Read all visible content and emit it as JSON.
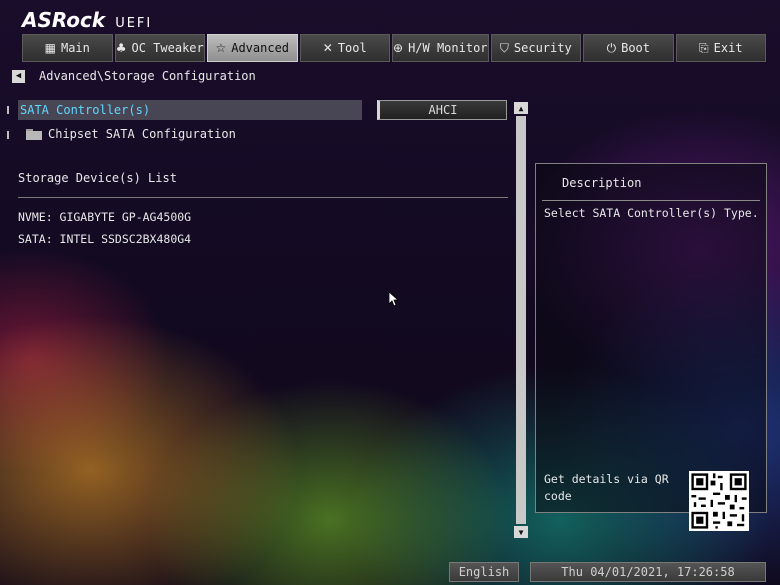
{
  "brand": {
    "name": "ASRock",
    "product": "UEFI"
  },
  "tabs": [
    {
      "label": "Main",
      "icon": "grid-icon",
      "active": false
    },
    {
      "label": "OC Tweaker",
      "icon": "rocket-icon",
      "active": false
    },
    {
      "label": "Advanced",
      "icon": "star-icon",
      "active": true
    },
    {
      "label": "Tool",
      "icon": "tools-icon",
      "active": false
    },
    {
      "label": "H/W Monitor",
      "icon": "monitor-icon",
      "active": false
    },
    {
      "label": "Security",
      "icon": "shield-icon",
      "active": false
    },
    {
      "label": "Boot",
      "icon": "power-icon",
      "active": false
    },
    {
      "label": "Exit",
      "icon": "exit-icon",
      "active": false
    }
  ],
  "breadcrumb": "Advanced\\Storage Configuration",
  "settings": {
    "sata_controller": {
      "label": "SATA Controller(s)",
      "value": "AHCI"
    },
    "chipset_sata": {
      "label": "Chipset SATA Configuration"
    }
  },
  "storage": {
    "title": "Storage Device(s) List",
    "devices": [
      "NVME: GIGABYTE GP-AG4500G",
      "SATA: INTEL SSDSC2BX480G4"
    ]
  },
  "description": {
    "title": "Description",
    "text": "Select SATA Controller(s) Type.",
    "qr_label": "Get details via QR code"
  },
  "footer": {
    "language": "English",
    "datetime": "Thu 04/01/2021, 17:26:58"
  },
  "colors": {
    "selected_text": "#5fd7ff",
    "active_tab": "#bdbdbd"
  }
}
